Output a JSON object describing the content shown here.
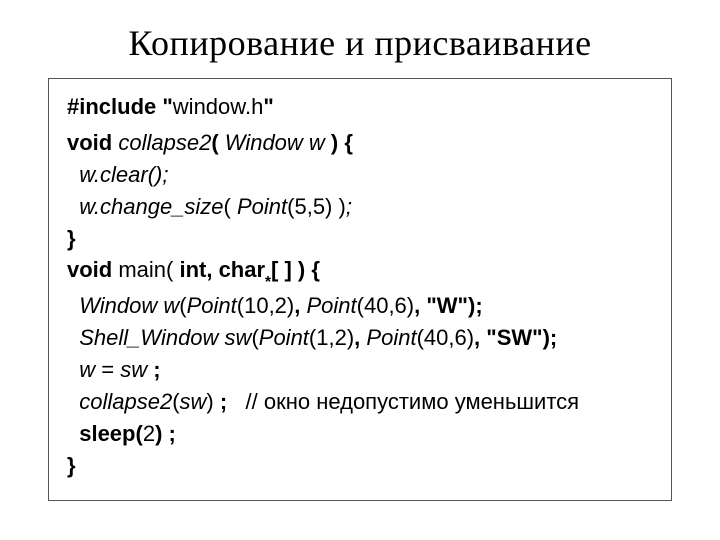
{
  "title": "Копирование и присваивание",
  "code": {
    "l1a": "#include \"",
    "l1b": "window.h",
    "l1c": "\"",
    "l2a": "void",
    "l2b": " collapse2",
    "l2c": "(",
    "l2d": " Window w ",
    "l2e": ") {",
    "l3": "  w.clear();",
    "l4a": "  w.change_size",
    "l4b": "(",
    "l4c": " Point",
    "l4d": "(5,5) )",
    "l4e": ";",
    "l5": "}",
    "l6a": "void ",
    "l6b": "main",
    "l6c": "(",
    "l6d": " int, char",
    "l6e": "*",
    "l6f": "[ ] ) {",
    "l7a": "  Window w",
    "l7b": "(",
    "l7c": "Point",
    "l7d": "(10,2)",
    "l7e": ",",
    "l7f": " Point",
    "l7g": "(40,6)",
    "l7h": ",",
    "l7i": " \"W\");",
    "l8a": "  Shell_Window sw",
    "l8b": "(",
    "l8c": "Point",
    "l8d": "(1,2)",
    "l8e": ",",
    "l8f": " Point",
    "l8g": "(40,6)",
    "l8h": ",",
    "l8i": " \"SW\");",
    "l9a": "  w ",
    "l9b": "=",
    "l9c": " sw ",
    "l9d": ";",
    "l10a": "  collapse2",
    "l10b": "(",
    "l10c": "sw",
    "l10d": ")",
    "l10e": " ;   ",
    "l10f": "// окно недопустимо уменьшится",
    "l11a": "  sleep(",
    "l11b": "2",
    "l11c": ") ;",
    "l12": "}"
  }
}
